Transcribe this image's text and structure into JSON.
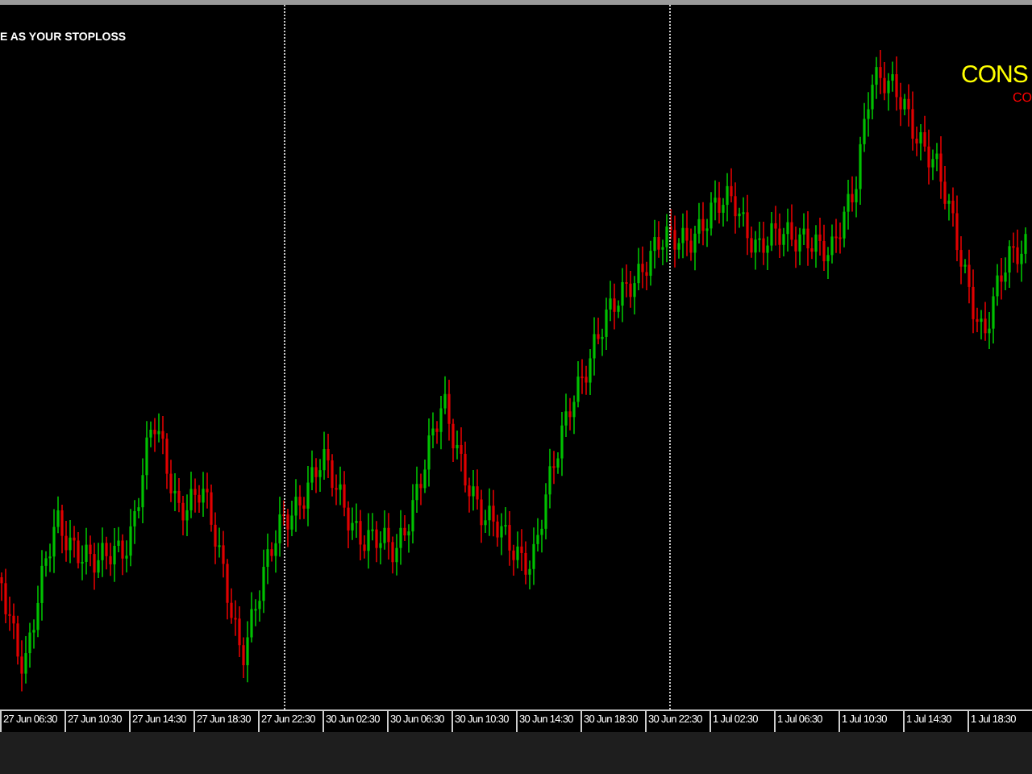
{
  "indicator_text": "E AS YOUR STOPLOSS",
  "title": "CONS",
  "subtitle": "CO",
  "time_axis": [
    "27 Jun 06:30",
    "27 Jun 10:30",
    "27 Jun 14:30",
    "27 Jun 18:30",
    "27 Jun 22:30",
    "30 Jun 02:30",
    "30 Jun 06:30",
    "30 Jun 10:30",
    "30 Jun 14:30",
    "30 Jun 18:30",
    "30 Jun 22:30",
    "1 Jul 02:30",
    "1 Jul 06:30",
    "1 Jul 10:30",
    "1 Jul 14:30",
    "1 Jul 18:30"
  ]
}
